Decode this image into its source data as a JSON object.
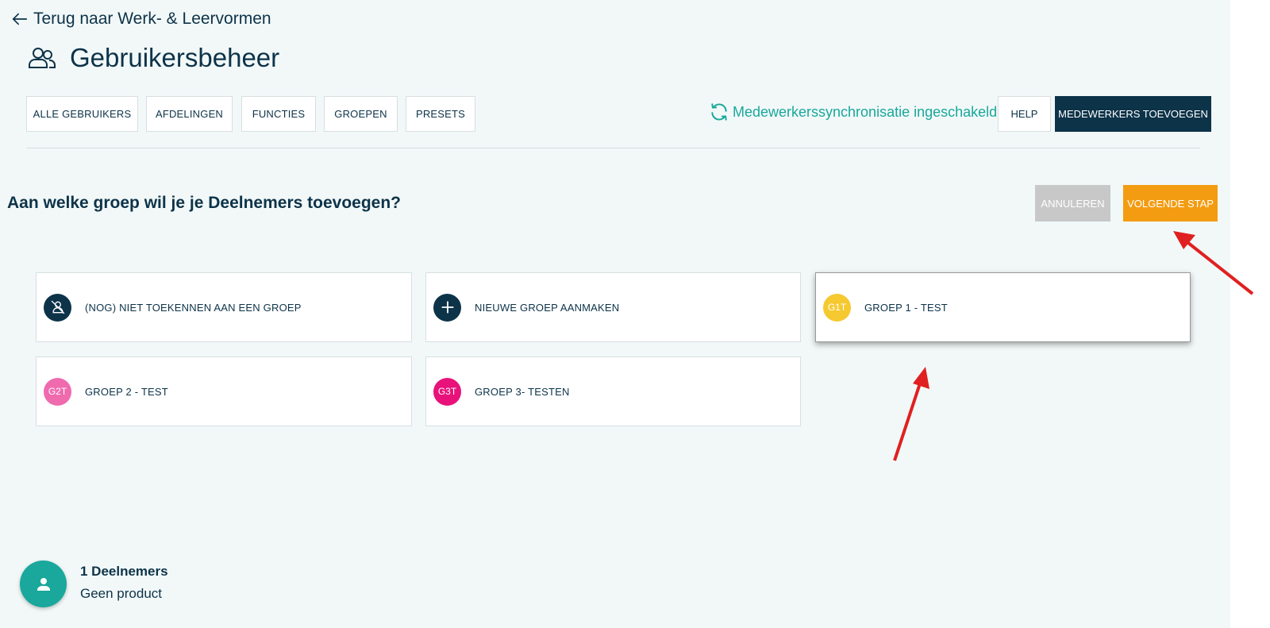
{
  "back": {
    "label": "Terug naar Werk- & Leervormen"
  },
  "header": {
    "title": "Gebruikersbeheer"
  },
  "tabs": [
    {
      "label": "ALLE GEBRUIKERS"
    },
    {
      "label": "AFDELINGEN"
    },
    {
      "label": "FUNCTIES"
    },
    {
      "label": "GROEPEN"
    },
    {
      "label": "PRESETS"
    }
  ],
  "sync": {
    "label": "Medewerkerssynchronisatie ingeschakeld",
    "color": "#19a89b"
  },
  "actions": {
    "help": "HELP",
    "add_employees": "MEDEWERKERS TOEVOEGEN"
  },
  "step": {
    "question": "Aan welke groep wil je je Deelnemers toevoegen?",
    "cancel": "ANNULEREN",
    "next": "VOLGENDE STAP",
    "next_color": "#f39c12"
  },
  "groups": [
    {
      "label": "(NOG) NIET TOEKENNEN AAN EEN GROEP",
      "icon": "no-group-icon",
      "color": "#0d3349"
    },
    {
      "label": "NIEUWE GROEP AANMAKEN",
      "icon": "plus-icon",
      "color": "#0d3349"
    },
    {
      "label": "GROEP 1 - TEST",
      "badge": "G1T",
      "color": "#f5c92f",
      "selected": true
    },
    {
      "label": "GROEP 2 - TEST",
      "badge": "G2T",
      "color": "#f06aae"
    },
    {
      "label": "GROEP 3- TESTEN",
      "badge": "G3T",
      "color": "#e8127a"
    }
  ],
  "participants": {
    "count": "1 Deelnemers",
    "product": "Geen product",
    "icon": "user-icon"
  },
  "annotations": {
    "arrow_color": "#e02020"
  }
}
